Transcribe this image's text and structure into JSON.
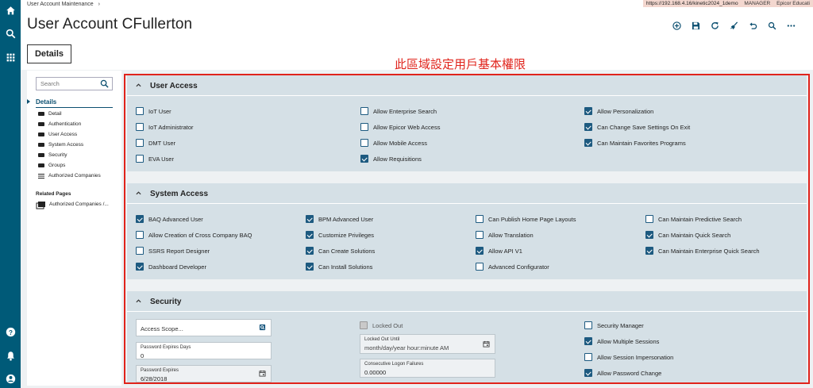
{
  "breadcrumb": "User Account Maintenance",
  "breadcrumb_sep": "›",
  "env": {
    "url": "https://192.168.4.16/kinetic2024_1demo",
    "role": "MANAGER",
    "company": "Epicor Educati"
  },
  "page_title": "User Account CFullerton",
  "tab": "Details",
  "annotation": "此區域設定用戶基本權限",
  "nav": {
    "search_placeholder": "Search",
    "group": "Details",
    "items": [
      "Detail",
      "Authentication",
      "User Access",
      "System Access",
      "Security",
      "Groups",
      "Authorized Companies"
    ],
    "related_title": "Related Pages",
    "related_items": [
      "Authorized Companies /..."
    ]
  },
  "sections": {
    "user_access": {
      "title": "User Access",
      "checkboxes": [
        {
          "label": "IoT User",
          "checked": false
        },
        {
          "label": "IoT Administrator",
          "checked": false
        },
        {
          "label": "DMT User",
          "checked": false
        },
        {
          "label": "EVA User",
          "checked": false
        },
        {
          "label": "Allow Enterprise Search",
          "checked": false
        },
        {
          "label": "Allow Epicor Web Access",
          "checked": false
        },
        {
          "label": "Allow Mobile Access",
          "checked": false
        },
        {
          "label": "Allow Requisitions",
          "checked": true
        },
        {
          "label": "Allow Personalization",
          "checked": true
        },
        {
          "label": "Can Change Save Settings On Exit",
          "checked": true
        },
        {
          "label": "Can Maintain Favorites Programs",
          "checked": true
        }
      ]
    },
    "system_access": {
      "title": "System Access",
      "checkboxes": [
        {
          "label": "BAQ Advanced User",
          "checked": true
        },
        {
          "label": "Allow Creation of Cross Company BAQ",
          "checked": false
        },
        {
          "label": "SSRS Report Designer",
          "checked": false
        },
        {
          "label": "Dashboard Developer",
          "checked": true
        },
        {
          "label": "BPM Advanced User",
          "checked": true
        },
        {
          "label": "Customize Privileges",
          "checked": true
        },
        {
          "label": "Can Create Solutions",
          "checked": true
        },
        {
          "label": "Can Install Solutions",
          "checked": true
        },
        {
          "label": "Can Publish Home Page Layouts",
          "checked": false
        },
        {
          "label": "Allow Translation",
          "checked": false
        },
        {
          "label": "Allow API V1",
          "checked": true
        },
        {
          "label": "Advanced Configurator",
          "checked": false
        },
        {
          "label": "Can Maintain Predictive Search",
          "checked": false
        },
        {
          "label": "Can Maintain Quick Search",
          "checked": true
        },
        {
          "label": "Can Maintain Enterprise Quick Search",
          "checked": true
        }
      ]
    },
    "security": {
      "title": "Security",
      "access_scope_placeholder": "Access Scope...",
      "password_expires_days_label": "Password Expires Days",
      "password_expires_days": "0",
      "password_expires_label": "Password Expires",
      "password_expires": "6/28/2018",
      "locked_out_label": "Locked Out",
      "locked_out": false,
      "locked_out_until_label": "Locked Out Until",
      "locked_out_until_placeholder": "month/day/year hour:minute AM",
      "consecutive_failures_label": "Consecutive Logon Failures",
      "consecutive_failures": "0.00000",
      "checkboxes": [
        {
          "label": "Security Manager",
          "checked": false
        },
        {
          "label": "Allow Multiple Sessions",
          "checked": true
        },
        {
          "label": "Allow Session Impersonation",
          "checked": false
        },
        {
          "label": "Allow Password Change",
          "checked": true
        }
      ]
    }
  },
  "colors": {
    "rail": "#005a78",
    "accent": "#1d5a80",
    "annotation": "#e0231b",
    "section_bg": "#d5e0e6"
  },
  "icons": {
    "rail_top": [
      "home-icon",
      "search-icon",
      "apps-grid-icon"
    ],
    "rail_bottom": [
      "help-icon",
      "bell-icon",
      "user-icon"
    ],
    "toolbar": [
      "add-icon",
      "save-icon",
      "refresh-icon",
      "clear-icon",
      "undo-icon",
      "search-icon",
      "more-icon"
    ]
  }
}
